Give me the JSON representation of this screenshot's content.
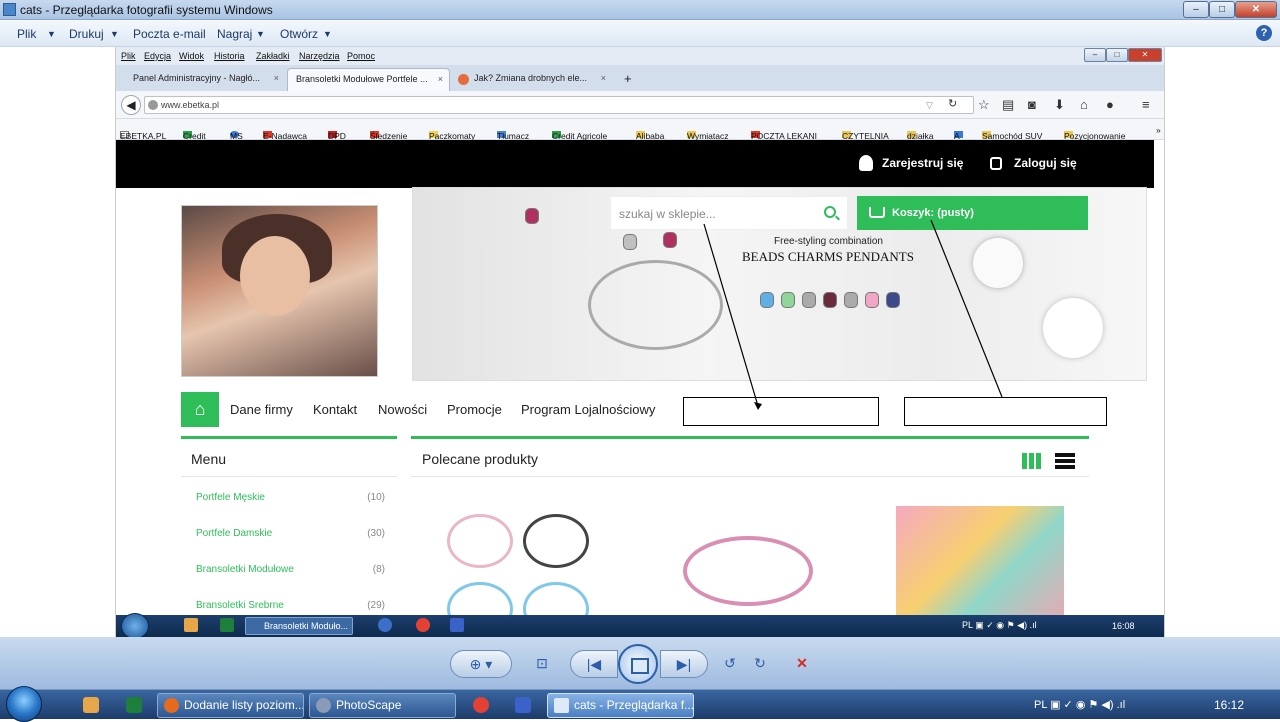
{
  "viewer": {
    "title": "cats - Przeglądarka fotografii systemu Windows",
    "menu": [
      "Plik",
      "Drukuj",
      "Poczta e-mail",
      "Nagraj",
      "Otwórz"
    ]
  },
  "firefox": {
    "menu": [
      "Plik",
      "Edycja",
      "Widok",
      "Historia",
      "Zakładki",
      "Narzędzia",
      "Pomoc"
    ],
    "tabs": [
      "Panel Administracyjny - Nagłó...",
      "Bransoletki Modułowe Portfele ...",
      "Jak? Zmiana drobnych ele..."
    ],
    "url": "www.ebetka.pl",
    "bookmarks": [
      "EBETKA.PL",
      "Credit",
      "MS",
      "E-Nadawca",
      "DPD",
      "Śledzenie",
      "Paczkomaty",
      "Tłumacz",
      "Credit Agricole",
      "Alibaba",
      "Wymiatacz",
      "POCZTA LEKANI",
      "CZYTELNIA",
      "działka",
      "A",
      "Samochód SUV",
      "Pozycjonowanie"
    ]
  },
  "site": {
    "register": "Zarejestruj się",
    "login": "Zaloguj się",
    "search_placeholder": "szukaj w sklepie...",
    "cart": "Koszyk: (pusty)",
    "banner_sub": "Free-styling combination",
    "banner_title": "BEADS CHARMS PENDANTS",
    "nav": [
      "Dane firmy",
      "Kontakt",
      "Nowości",
      "Promocje",
      "Program Lojalnościowy"
    ],
    "menu_title": "Menu",
    "categories": [
      {
        "name": "Portfele Męskie",
        "count": "(10)"
      },
      {
        "name": "Portfele Damskie",
        "count": "(30)"
      },
      {
        "name": "Bransoletki Modułowe",
        "count": "(8)"
      },
      {
        "name": "Bransoletki Srebrne",
        "count": "(29)"
      }
    ],
    "products_title": "Polecane produkty"
  },
  "inner_taskbar": {
    "task": "Bransoletki Moduło...",
    "lang": "PL",
    "clock": "16:08"
  },
  "taskbar": {
    "tasks": [
      "Dodanie listy poziom...",
      "PhotoScape",
      "cats - Przeglądarka f..."
    ],
    "lang": "PL",
    "clock": "16:12"
  }
}
